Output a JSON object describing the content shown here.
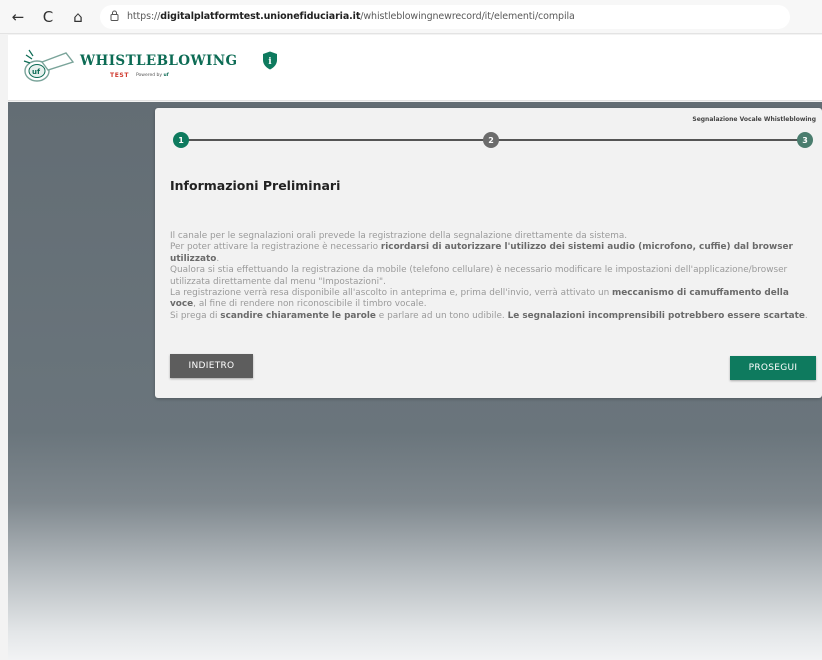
{
  "browser": {
    "back_icon": "←",
    "reload_icon": "C",
    "home_icon": "⌂",
    "lock_icon": "🔒",
    "url_prefix": "https://",
    "url_domain": "digitalplatformtest.unionefiduciaria.it",
    "url_path": "/whistleblowingnewrecord/it/elementi/compila"
  },
  "header": {
    "brand_title": "WHISTLEBLOWING",
    "brand_sub": "TEST",
    "powered_text": "Powered by",
    "powered_brand": "uf",
    "shield_icon": "i"
  },
  "card": {
    "step_caption": "Segnalazione Vocale Whistleblowing",
    "steps": [
      {
        "label": "1",
        "state": "active"
      },
      {
        "label": "2",
        "state": "pending"
      },
      {
        "label": "3",
        "state": "pending"
      }
    ],
    "title": "Informazioni Preliminari",
    "p1": "Il canale per le segnalazioni orali prevede la registrazione della segnalazione direttamente da sistema.",
    "p2_a": "Per poter attivare la registrazione è necessario ",
    "p2_b": "ricordarsi di autorizzare l'utilizzo dei sistemi audio (microfono, cuffie) dal browser utilizzato",
    "p2_c": ".",
    "p3": "Qualora si stia effettuando la registrazione da mobile (telefono cellulare) è necessario modificare le impostazioni dell'applicazione/browser utilizzata direttamente dal menu \"Impostazioni\".",
    "p4_a": "La registrazione verrà resa disponibile all'ascolto in anteprima e, prima dell'invio, verrà attivato un ",
    "p4_b": "meccanismo di camuffamento della voce",
    "p4_c": ", al fine di rendere non riconoscibile il timbro vocale.",
    "p5_a": "Si prega di ",
    "p5_b": "scandire chiaramente le parole",
    "p5_c": " e parlare ad un tono udibile. ",
    "p5_d": "Le segnalazioni incomprensibili potrebbero essere scartate",
    "p5_e": ".",
    "back_label": "INDIETRO",
    "next_label": "PROSEGUI"
  },
  "colors": {
    "brand_green": "#0e7a5e",
    "back_button": "#5d5d5d",
    "brand_red": "#d03a2f"
  }
}
